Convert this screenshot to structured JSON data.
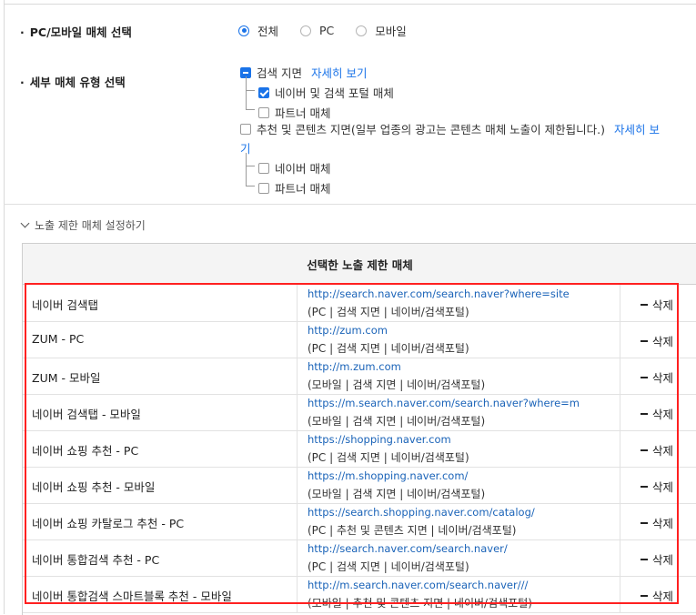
{
  "media_select": {
    "label": "PC/모바일 매체 선택",
    "options": [
      "전체",
      "PC",
      "모바일"
    ],
    "selected": "전체"
  },
  "type_select": {
    "label": "세부 매체 유형 선택",
    "search": {
      "label": "검색 지면",
      "link": "자세히 보기",
      "children": [
        "네이버 및 검색 포털 매체",
        "파트너 매체"
      ]
    },
    "content": {
      "label": "추천 및 콘텐츠 지면(일부 업종의 광고는 콘텐츠 매체 노출이 제한됩니다.)",
      "link_part1": "자세히 보",
      "link_part2": "기",
      "children": [
        "네이버 매체",
        "파트너 매체"
      ]
    }
  },
  "toggle": {
    "label": "노출 제한 매체 설정하기"
  },
  "table": {
    "header": "선택한 노출 제한 매체",
    "delete_label": "삭제",
    "rows": [
      {
        "name": "네이버 검색탭",
        "url": "http://search.naver.com/search.naver?where=site",
        "meta": "(PC | 검색 지면 | 네이버/검색포털)"
      },
      {
        "name": "ZUM - PC",
        "url": "http://zum.com",
        "meta": "(PC | 검색 지면 | 네이버/검색포털)"
      },
      {
        "name": "ZUM - 모바일",
        "url": "http://m.zum.com",
        "meta": "(모바일 | 검색 지면 | 네이버/검색포털)"
      },
      {
        "name": "네이버 검색탭 - 모바일",
        "url": "https://m.search.naver.com/search.naver?where=m",
        "meta": "(모바일 | 검색 지면 | 네이버/검색포털)"
      },
      {
        "name": "네이버 쇼핑 추천 - PC",
        "url": "https://shopping.naver.com",
        "meta": "(PC | 검색 지면 | 네이버/검색포털)"
      },
      {
        "name": "네이버 쇼핑 추천 - 모바일",
        "url": "https://m.shopping.naver.com/",
        "meta": "(모바일 | 검색 지면 | 네이버/검색포털)"
      },
      {
        "name": "네이버 쇼핑 카탈로그 추천 - PC",
        "url": "https://search.shopping.naver.com/catalog/",
        "meta": "(PC | 추천 및 콘텐츠 지면 | 네이버/검색포털)"
      },
      {
        "name": "네이버 통합검색 추천 - PC",
        "url": "http://search.naver.com/search.naver/",
        "meta": "(PC | 검색 지면 | 네이버/검색포털)"
      },
      {
        "name": "네이버 통합검색 스마트블록 추천 - 모바일",
        "url": "http://m.search.naver.com/search.naver///",
        "meta": "(모바일 | 추천 및 콘텐츠 지면 | 네이버/검색포털)"
      }
    ]
  },
  "colors": {
    "accent": "#1a73e8",
    "link": "#1a63b8",
    "highlight": "#ff2020"
  }
}
